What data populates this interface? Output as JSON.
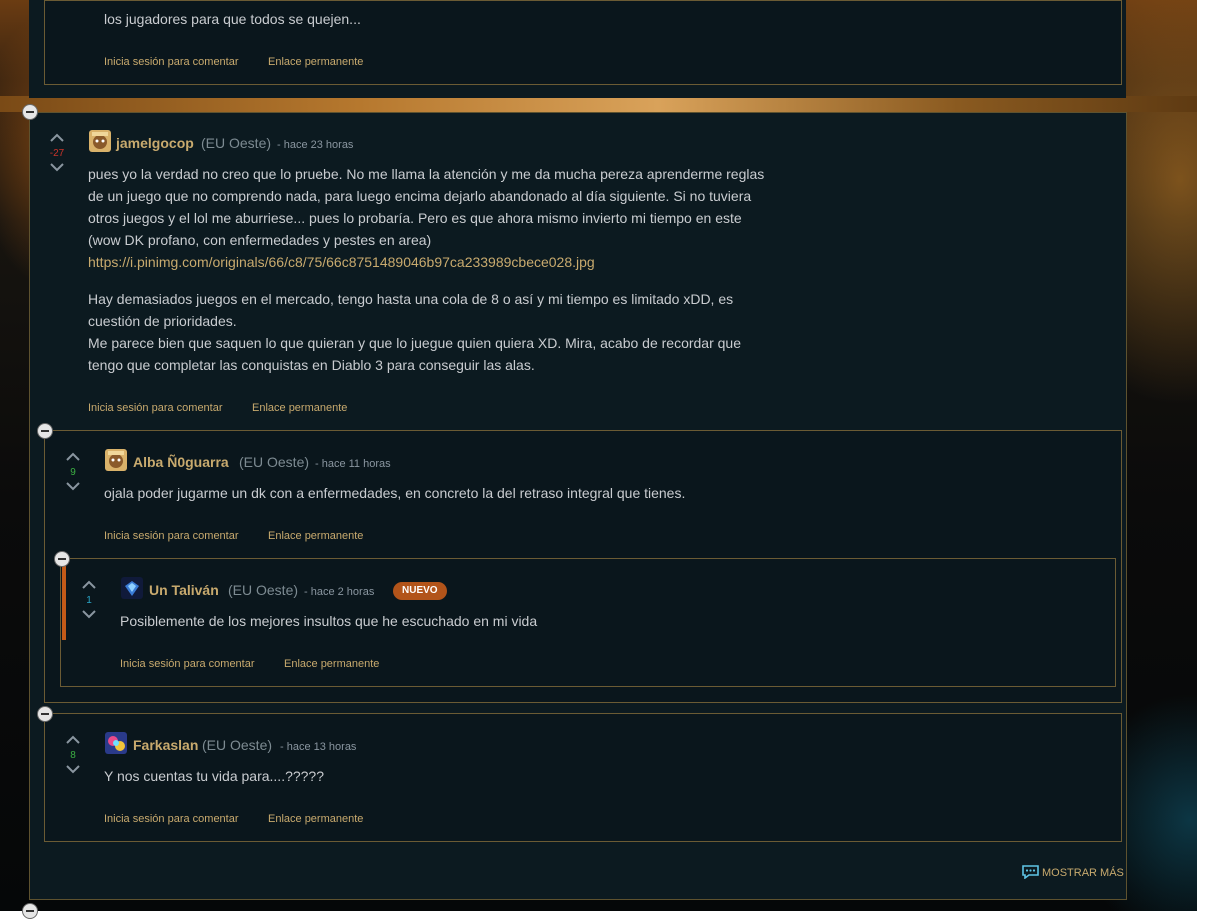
{
  "comments": {
    "prev": {
      "text_line": "los jugadores para que todos se quejen...",
      "action_login": "Inicia sesión para comentar",
      "action_permalink": "Enlace permanente"
    },
    "main": {
      "score": "-27",
      "author": "jamelgocop",
      "region": "(EU Oeste)",
      "time": "- hace 23 horas",
      "lines": [
        "pues yo la verdad no creo que lo pruebe. No me llama la atención y me da mucha pereza aprenderme reglas",
        "de un juego que no comprendo nada, para luego encima dejarlo abandonado al día siguiente. Si no tuviera",
        "otros juegos y el lol me aburriese... pues lo probaría. Pero es que ahora mismo invierto mi tiempo en este",
        "(wow DK profano, con enfermedades y pestes en area)"
      ],
      "link": "https://i.pinimg.com/originals/66/c8/75/66c8751489046b97ca233989cbece028.jpg",
      "lines2": [
        "Hay demasiados juegos en el mercado, tengo hasta una cola de 8 o así y mi tiempo es limitado xDD, es",
        "cuestión de prioridades.",
        "Me parece bien que saquen lo que quieran y que lo juegue quien quiera XD. Mira, acabo de recordar que",
        "tengo que completar las conquistas en Diablo 3 para conseguir las alas."
      ],
      "action_login": "Inicia sesión para comentar",
      "action_permalink": "Enlace permanente"
    },
    "reply1": {
      "score": "9",
      "author": "Alba Ñ0guarra",
      "region": "(EU Oeste)",
      "time": "- hace 11 horas",
      "text": "ojala poder jugarme un dk con a enfermedades, en concreto la del retraso integral que tienes.",
      "action_login": "Inicia sesión para comentar",
      "action_permalink": "Enlace permanente"
    },
    "reply1_1": {
      "score": "1",
      "author": "Un Taliván",
      "region": "(EU Oeste)",
      "time": "- hace 2 horas",
      "badge": "NUEVO",
      "text": "Posiblemente de los mejores insultos que he escuchado en mi vida",
      "action_login": "Inicia sesión para comentar",
      "action_permalink": "Enlace permanente"
    },
    "reply2": {
      "score": "8",
      "author": "Farkaslan",
      "region": "(EU Oeste)",
      "time": "- hace 13 horas",
      "text": "Y nos cuentas tu vida para....?????",
      "action_login": "Inicia sesión para comentar",
      "action_permalink": "Enlace permanente"
    }
  },
  "show_more": "MOSTRAR MÁS",
  "colors": {
    "gold": "#c8aa6e",
    "panel": "#0c1a20",
    "negative": "#c9342a",
    "positive": "#3cb043",
    "badge": "#b2541a"
  },
  "icons": {
    "collapse": "collapse-minus-icon",
    "upvote": "chevron-up-icon",
    "downvote": "chevron-down-icon",
    "show_more": "chat-bubble-icon"
  }
}
